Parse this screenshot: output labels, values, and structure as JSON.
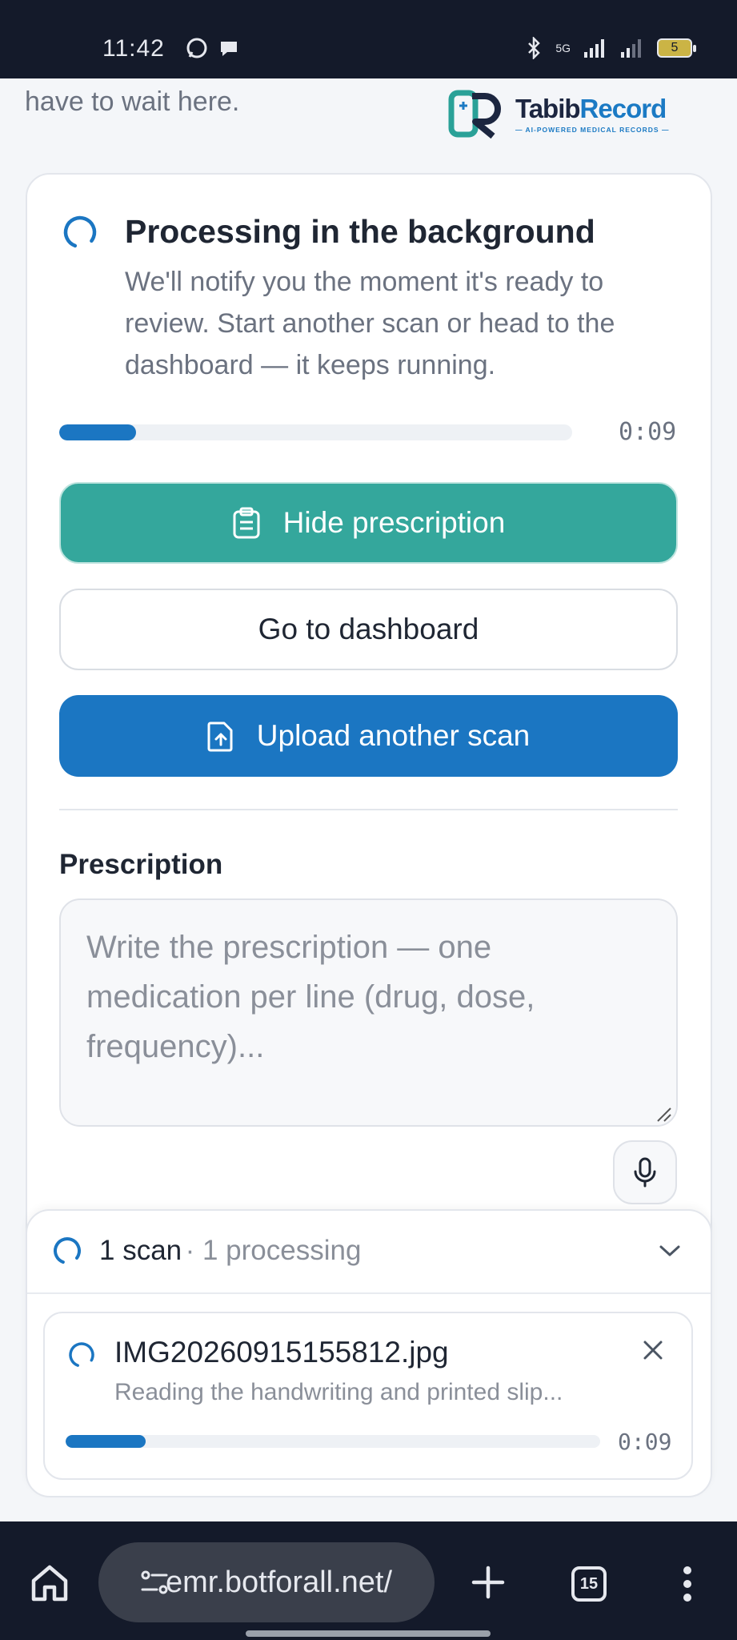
{
  "status_bar": {
    "time": "11:42",
    "battery": "5",
    "network": "5G"
  },
  "top": {
    "wait_text": "have to wait here."
  },
  "logo": {
    "name_part1": "Tabib",
    "name_part2": "Record",
    "tagline": "— AI-POWERED MEDICAL RECORDS —"
  },
  "processing": {
    "title": "Processing in the background",
    "description": "We'll notify you the moment it's ready to review. Start another scan or head to the dashboard — it keeps running.",
    "progress_fraction": 0.15,
    "timer": "0:09"
  },
  "buttons": {
    "hide_prescription": "Hide prescription",
    "go_to_dashboard": "Go to dashboard",
    "upload_another_scan": "Upload another scan"
  },
  "prescription": {
    "label": "Prescription",
    "placeholder": "Write the prescription — one medication per line (drug, dose, frequency)...",
    "value": ""
  },
  "scan_panel": {
    "count_label": "1 scan",
    "sub_label": "· 1 processing",
    "item": {
      "filename": "IMG20260915155812.jpg",
      "status": "Reading the handwriting and printed slip...",
      "progress_fraction": 0.15,
      "timer": "0:09"
    }
  },
  "browser": {
    "url": "emr.botforall.net/",
    "tab_count": "15"
  },
  "colors": {
    "teal": "#34a79c",
    "blue": "#1b76c2",
    "dark_bar": "#141a2a"
  }
}
